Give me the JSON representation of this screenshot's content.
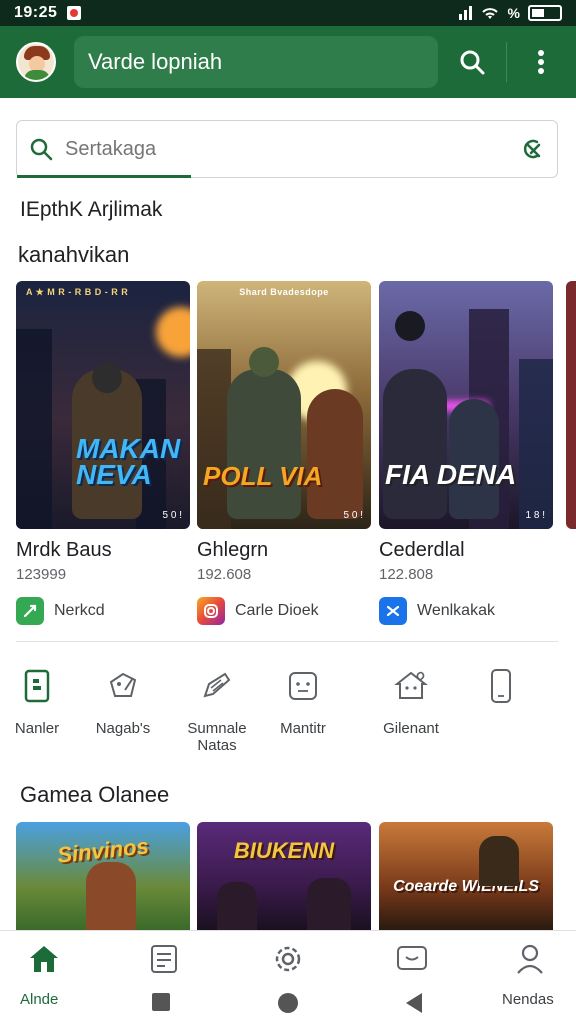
{
  "status_bar": {
    "time": "19:25",
    "battery": "%"
  },
  "app_bar": {
    "title": "Varde lopniah"
  },
  "search": {
    "placeholder": "Sertakaga"
  },
  "section_heading": "IEpthK Arjlimak",
  "subsection_heading": "kanahvikan",
  "featured": [
    {
      "title": "Mrdk Baus",
      "count": "123999",
      "publisher": "Nerkcd",
      "publisher_color": "#34a853",
      "art_tagline": "A ★ M  R - R   B D - R R",
      "art_logo": "MAKAN NEVA",
      "art_badge": "5 0 !"
    },
    {
      "title": "Ghlegrn",
      "count": "192.608",
      "publisher": "Carle Dioek",
      "publisher_color": "#e8483b",
      "art_tagline": "Shard Bvadesdope",
      "art_logo": "POLL  VIA",
      "art_badge": "5 0 !"
    },
    {
      "title": "Cederdlal",
      "count": "122.808",
      "publisher": "Wenlkakak",
      "publisher_color": "#1a73e8",
      "art_tagline": "",
      "art_logo": "FIA DENA",
      "art_badge": "1 8 !"
    }
  ],
  "categories": [
    {
      "label": "Nanler",
      "icon": "phone-card-icon"
    },
    {
      "label": "Nagab's",
      "icon": "tag-edit-icon"
    },
    {
      "label": "Sumnale Natas",
      "icon": "pencil-note-icon"
    },
    {
      "label": "Mantitr",
      "icon": "face-box-icon"
    },
    {
      "label": "Gilenant",
      "icon": "house-heart-icon"
    },
    {
      "label": "",
      "icon": "phone-outline-icon"
    }
  ],
  "games_heading": "Gamea Olanee",
  "games": [
    {
      "logo": "Sinvinos"
    },
    {
      "logo": "BIUKENN"
    },
    {
      "logo": "Coearde WIENEILS"
    }
  ],
  "bottom_nav": {
    "home_label": "Alnde",
    "account_label": "Nendas"
  },
  "colors": {
    "primary": "#1e6b3a",
    "status_bar": "#0d2a1c"
  }
}
